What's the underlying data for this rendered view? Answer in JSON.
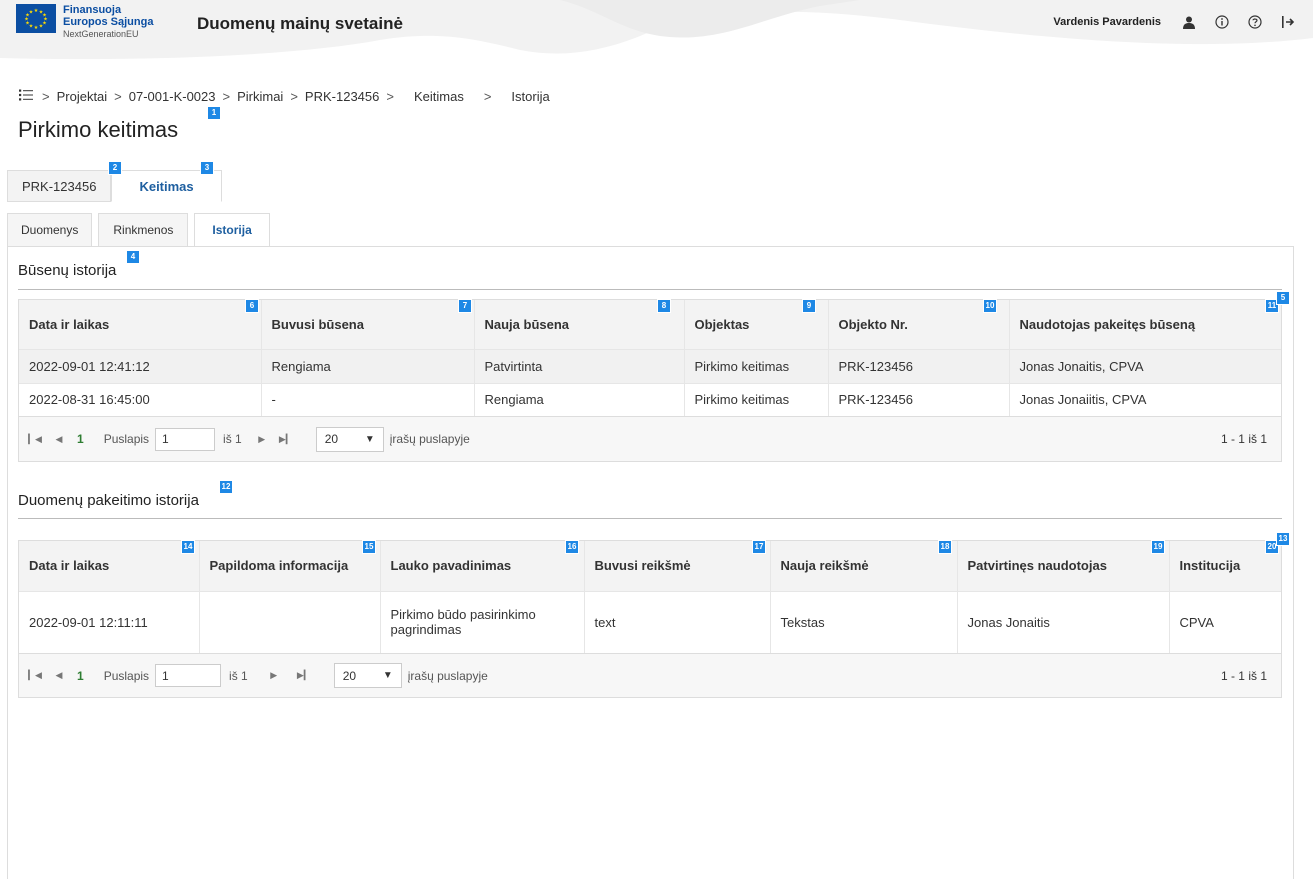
{
  "header": {
    "logo_line1": "Finansuoja",
    "logo_line2": "Europos Sąjunga",
    "logo_line3": "NextGenerationEU",
    "site_title": "Duomenų mainų svetainė",
    "user_name": "Vardenis Pavardenis",
    "icons": [
      "user-icon",
      "info-icon",
      "help-icon",
      "logout-icon"
    ]
  },
  "breadcrumb": {
    "items": [
      "Projektai",
      "07-001-K-0023",
      "Pirkimai",
      "PRK-123456",
      "Keitimas",
      "Istorija"
    ]
  },
  "page_title": "Pirkimo keitimas",
  "tabs_top": [
    "PRK-123456",
    "Keitimas"
  ],
  "tabs_sub": [
    "Duomenys",
    "Rinkmenos",
    "Istorija"
  ],
  "status_history": {
    "title": "Būsenų istorija",
    "columns": [
      "Data ir laikas",
      "Buvusi būsena",
      "Nauja būsena",
      "Objektas",
      "Objekto Nr.",
      "Naudotojas pakeitęs būseną"
    ],
    "rows": [
      [
        "2022-09-01 12:41:12",
        "Rengiama",
        "Patvirtinta",
        "Pirkimo keitimas",
        "PRK-123456",
        "Jonas Jonaitis, CPVA"
      ],
      [
        "2022-08-31 16:45:00",
        "-",
        "Rengiama",
        "Pirkimo keitimas",
        "PRK-123456",
        "Jonas Jonaiitis, CPVA"
      ]
    ],
    "pager": {
      "current": "1",
      "page_label": "Puslapis",
      "page_value": "1",
      "of_label": "iš 1",
      "size": "20",
      "per_page_label": "įrašų puslapyje",
      "info": "1 - 1 iš 1"
    }
  },
  "data_history": {
    "title": "Duomenų pakeitimo istorija",
    "columns": [
      "Data ir laikas",
      "Papildoma informacija",
      "Lauko pavadinimas",
      "Buvusi reikšmė",
      "Nauja reikšmė",
      "Patvirtinęs naudotojas",
      "Institucija"
    ],
    "rows": [
      [
        "2022-09-01 12:11:11",
        "",
        "Pirkimo būdo pasirinkimo pagrindimas",
        "text",
        "Tekstas",
        "Jonas Jonaitis",
        "CPVA"
      ]
    ],
    "pager": {
      "current": "1",
      "page_label": "Puslapis",
      "page_value": "1",
      "of_label": "iš 1",
      "size": "20",
      "per_page_label": "įrašų puslapyje",
      "info": "1 - 1 iš 1"
    }
  },
  "badges": [
    "1",
    "2",
    "3",
    "4",
    "5",
    "6",
    "7",
    "8",
    "9",
    "10",
    "11",
    "12",
    "13",
    "14",
    "15",
    "16",
    "17",
    "18",
    "19",
    "20"
  ],
  "colors": {
    "accent": "#1e88e5",
    "brand": "#0b4ea2",
    "tab_active": "#1e5fa0",
    "pager_current": "#2e7d32"
  }
}
